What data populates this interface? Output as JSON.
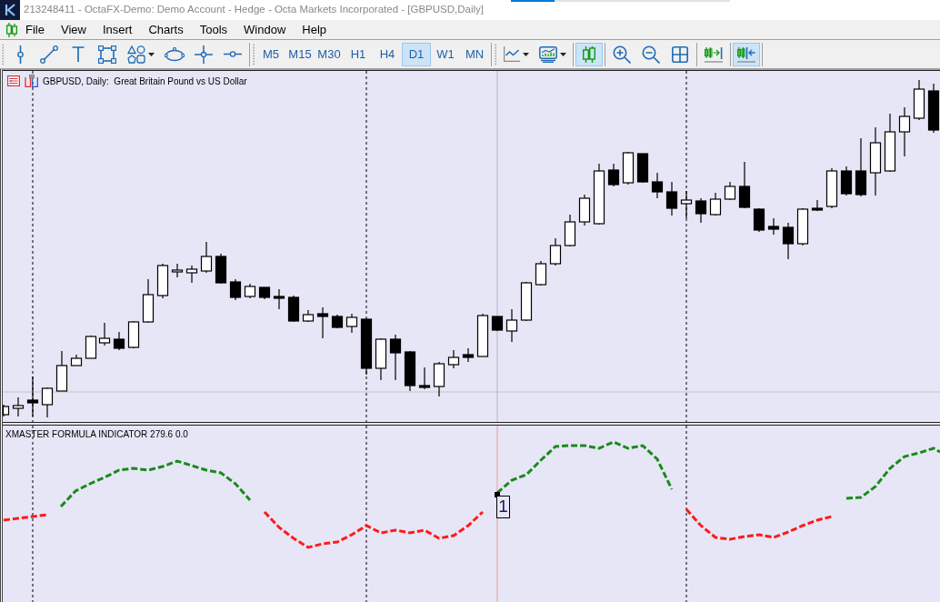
{
  "window": {
    "title": "213248411 - OctaFX-Demo: Demo Account - Hedge - Octa Markets Incorporated - [GBPUSD,Daily]"
  },
  "progress": {
    "level": 0.2
  },
  "menu": [
    "File",
    "View",
    "Insert",
    "Charts",
    "Tools",
    "Window",
    "Help"
  ],
  "toolbar": {
    "timeframes": [
      {
        "label": "M5",
        "selected": false
      },
      {
        "label": "M15",
        "selected": false
      },
      {
        "label": "M30",
        "selected": false
      },
      {
        "label": "H1",
        "selected": false
      },
      {
        "label": "H4",
        "selected": false
      },
      {
        "label": "D1",
        "selected": true
      },
      {
        "label": "W1",
        "selected": false
      },
      {
        "label": "MN",
        "selected": false
      }
    ],
    "candle_chart": {
      "pressed": true
    },
    "auto_scroll": {
      "pressed": false
    },
    "chart_shift": {
      "pressed": true
    }
  },
  "chart": {
    "title": "GBPUSD, Daily:  Great Britain Pound vs US Dollar",
    "text_label": "1"
  },
  "indicator": {
    "label": "XMASTER FORMULA INDICATOR 279.6 0.0"
  }
}
